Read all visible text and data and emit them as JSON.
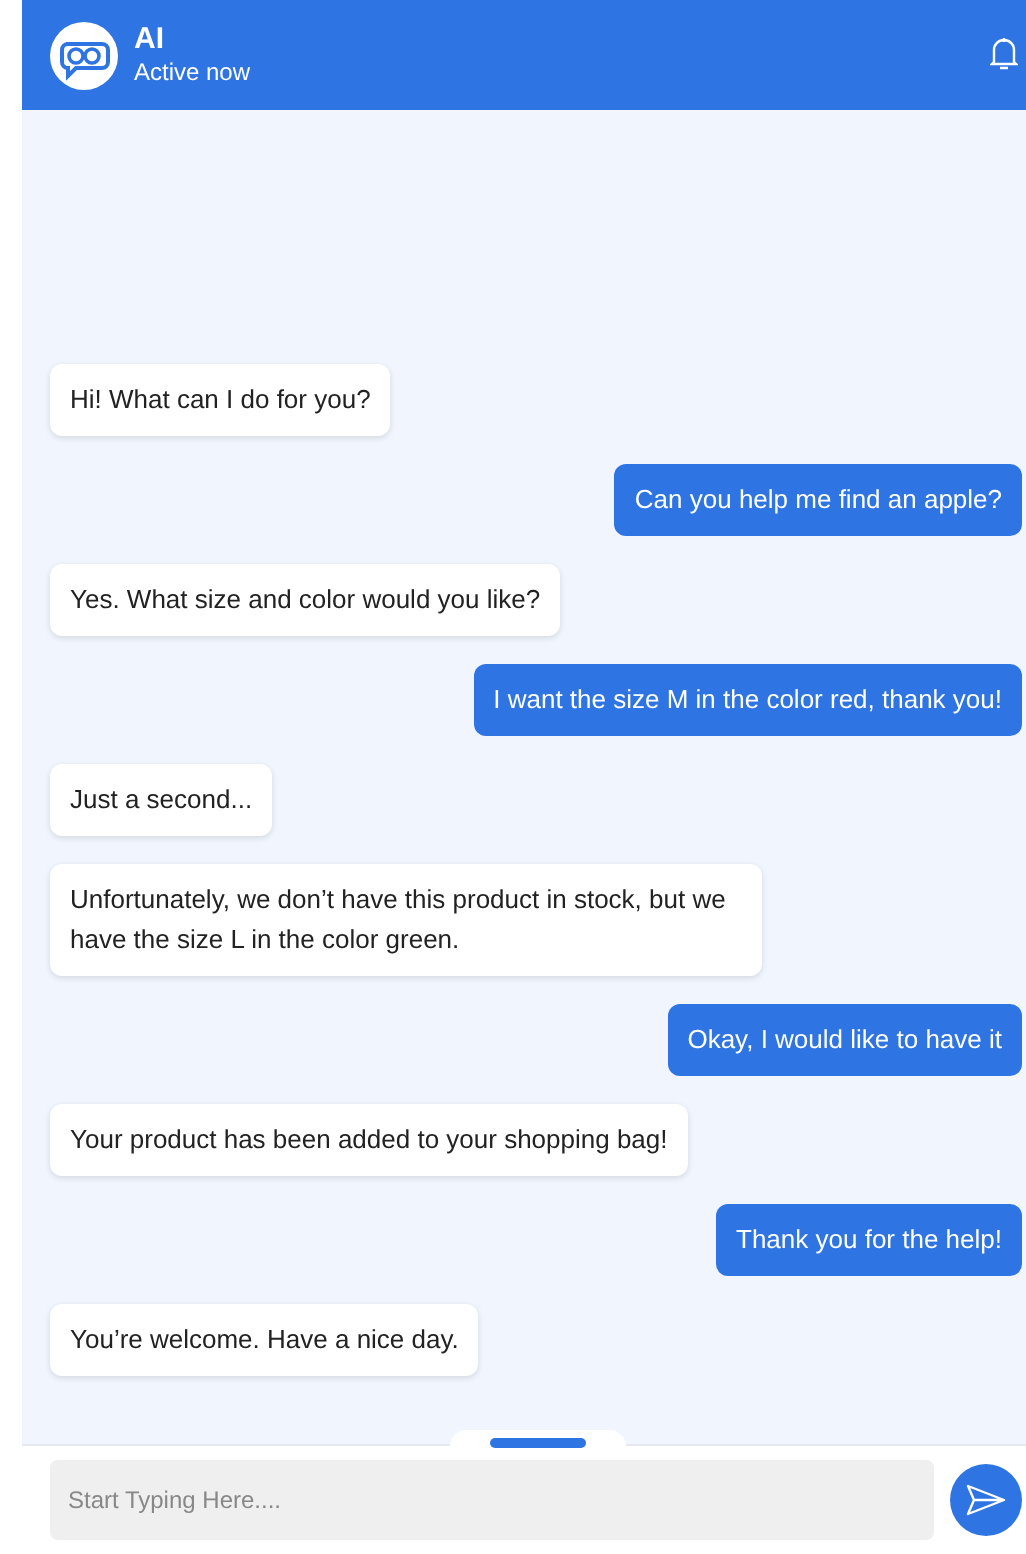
{
  "header": {
    "title": "AI",
    "status": "Active now"
  },
  "messages": [
    {
      "kind": "bot",
      "text": "Hi! What can I do for you?"
    },
    {
      "kind": "user",
      "text": "Can you help me find an apple?"
    },
    {
      "kind": "bot",
      "text": "Yes. What size and color would you like?"
    },
    {
      "kind": "user",
      "text": "I want the size M in the color red, thank you!"
    },
    {
      "kind": "bot",
      "text": "Just a second..."
    },
    {
      "kind": "bot",
      "text": "Unfortunately, we don’t have this product in stock, but we have the size L in the color green."
    },
    {
      "kind": "user",
      "text": "Okay, I would like to have it"
    },
    {
      "kind": "bot",
      "text": "Your product has been added to your shopping bag!"
    },
    {
      "kind": "user",
      "text": "Thank you for the help!"
    },
    {
      "kind": "bot",
      "text": "You’re welcome. Have a nice day."
    }
  ],
  "composer": {
    "placeholder": "Start Typing Here...."
  }
}
